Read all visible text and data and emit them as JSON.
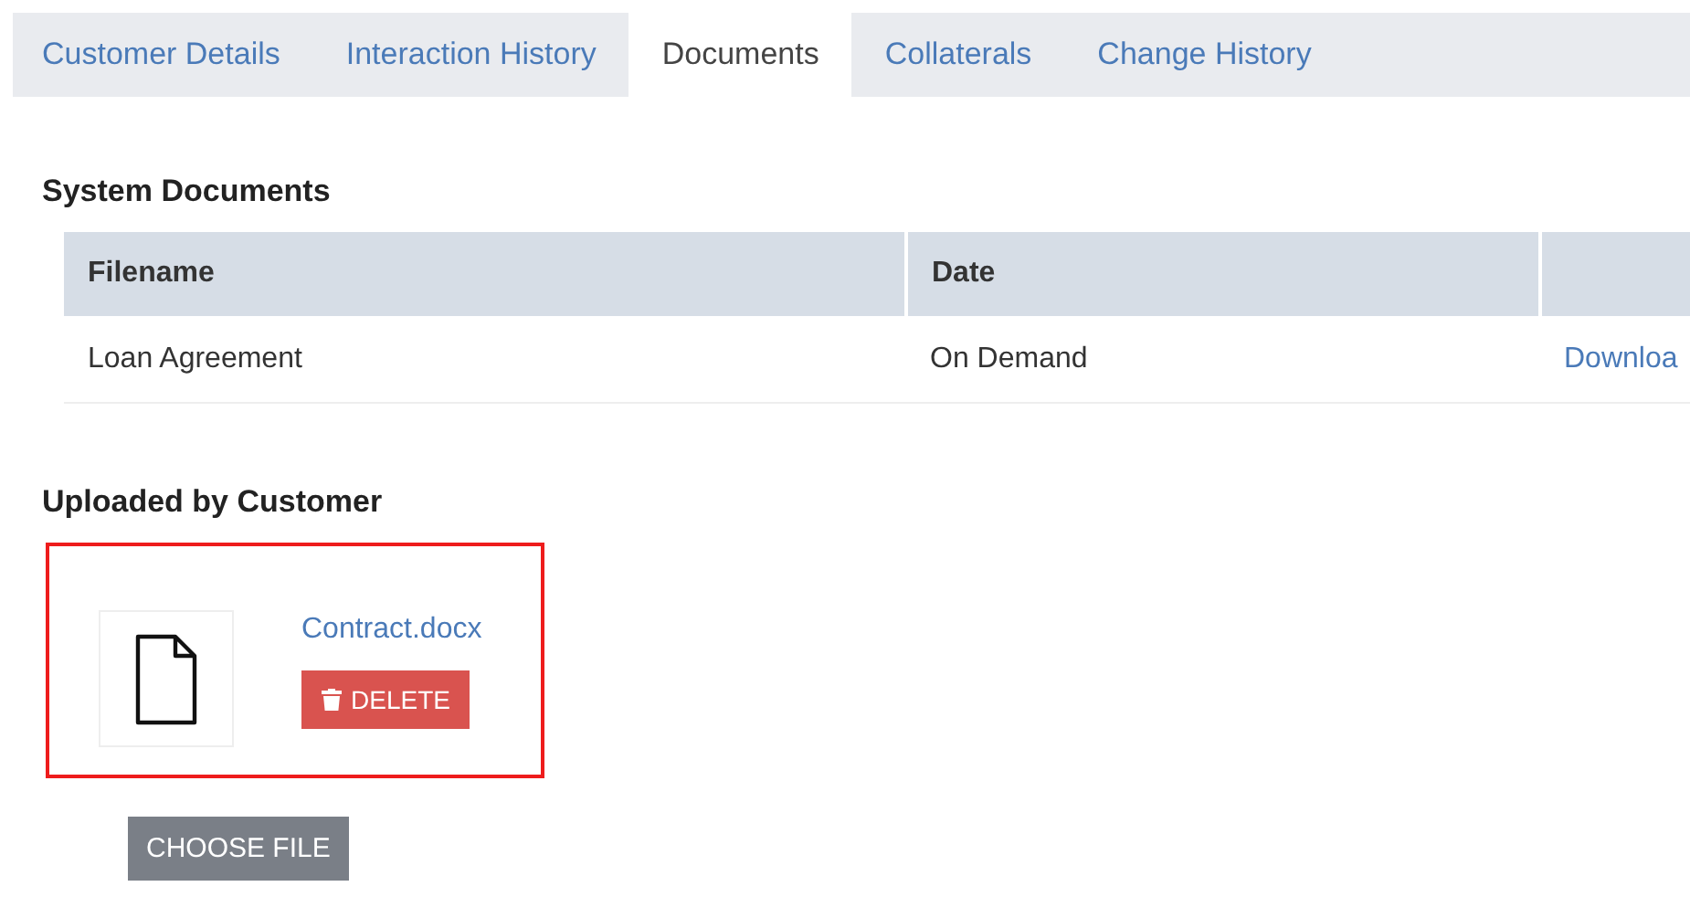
{
  "tabs": [
    {
      "label": "Customer Details",
      "selected": false
    },
    {
      "label": "Interaction History",
      "selected": false
    },
    {
      "label": "Documents",
      "selected": true
    },
    {
      "label": "Collaterals",
      "selected": false
    },
    {
      "label": "Change History",
      "selected": false
    }
  ],
  "system_documents": {
    "title": "System Documents",
    "columns": [
      "Filename",
      "Date"
    ],
    "rows": [
      {
        "filename": "Loan Agreement",
        "date": "On Demand",
        "action": "Downloa"
      }
    ]
  },
  "uploaded": {
    "title": "Uploaded by Customer",
    "files": [
      {
        "name": "Contract.docx",
        "delete_label": "DELETE",
        "highlighted": true
      }
    ],
    "choose_label": "CHOOSE FILE"
  }
}
